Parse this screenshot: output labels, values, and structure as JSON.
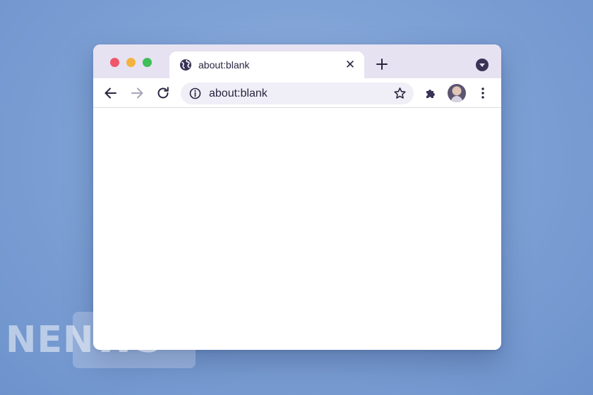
{
  "tab": {
    "title": "about:blank",
    "close": "✕"
  },
  "omnibox": {
    "url": "about:blank"
  },
  "watermark": {
    "text": "NENWS"
  },
  "colors": {
    "accent": "#3a3357",
    "titlebar": "#e6e2f1",
    "traffic_red": "#f0556a",
    "traffic_yellow": "#f4b23e",
    "traffic_green": "#3fbf55"
  },
  "icons": [
    "globe-icon",
    "close-icon",
    "plus-icon",
    "chevron-down-icon",
    "back-arrow-icon",
    "forward-arrow-icon",
    "reload-icon",
    "info-icon",
    "star-icon",
    "puzzle-icon",
    "avatar",
    "more-vert-icon"
  ]
}
